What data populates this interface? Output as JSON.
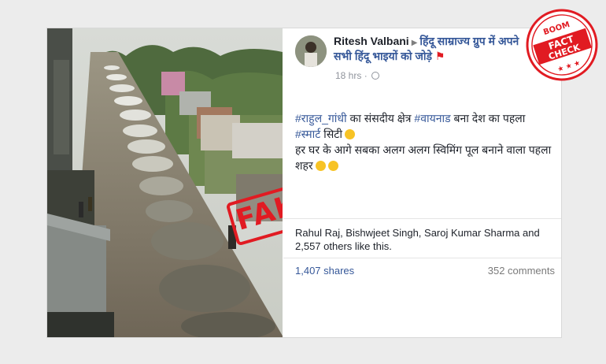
{
  "post": {
    "author": "Ritesh Valbani",
    "group": "हिंदू साम्राज्य ग्रुप में अपने सभी हिंदू भाइयों को जोड़े",
    "time": "18 hrs",
    "line1_hashtag1": "#राहुल_गांधी",
    "line1_mid": " का संसदीय क्षेत्र ",
    "line1_hashtag2": "#वायनाड",
    "line1_end": " बना देश का पहला",
    "line2_hashtag": "#स्मार्ट",
    "line2_end": " सिटी",
    "line3": "हर घर के आगे सबका अलग अलग स्विमिंग पूल बनाने वाला पहला शहर",
    "likes": "Rahul Raj, Bishwjeet Singh, Saroj Kumar Sharma and 2,557 others like this.",
    "shares": "1,407 shares",
    "comments": "352 comments"
  },
  "stamp": {
    "fake": "FAKE"
  },
  "badge": {
    "boom": "BOOM",
    "fact": "FACT",
    "check": "CHECK"
  },
  "colors": {
    "accent_red": "#e11b22",
    "link_blue": "#365899",
    "background": "#ececec"
  },
  "icons": {
    "privacy": "globe-icon",
    "arrow": "triangle-right-icon"
  }
}
